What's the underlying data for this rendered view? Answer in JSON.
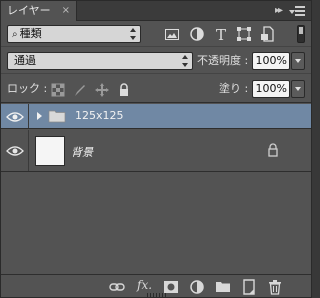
{
  "panel": {
    "tab_title": "レイヤー",
    "tab_close": "×",
    "collapse_glyph": "▸▸"
  },
  "filter": {
    "kind_label": "種類",
    "kind_icons": [
      "image-filter-icon",
      "adjustment-filter-icon",
      "type-filter-icon",
      "shape-filter-icon",
      "smart-object-filter-icon"
    ]
  },
  "blend": {
    "mode": "通過",
    "opacity_label": "不透明度 :",
    "opacity_value": "100%"
  },
  "lock": {
    "label": "ロック :",
    "fill_label": "塗り :",
    "fill_value": "100%"
  },
  "layers": [
    {
      "name": "125x125",
      "type": "group",
      "visible": true,
      "selected": true
    },
    {
      "name": "背景",
      "type": "background",
      "visible": true,
      "locked": true
    }
  ],
  "toolbar": {
    "fx_label": "fx."
  },
  "colors": {
    "panel_bg": "#535353",
    "selected_row": "#7088a4",
    "field_bg": "#d6d6d6"
  }
}
